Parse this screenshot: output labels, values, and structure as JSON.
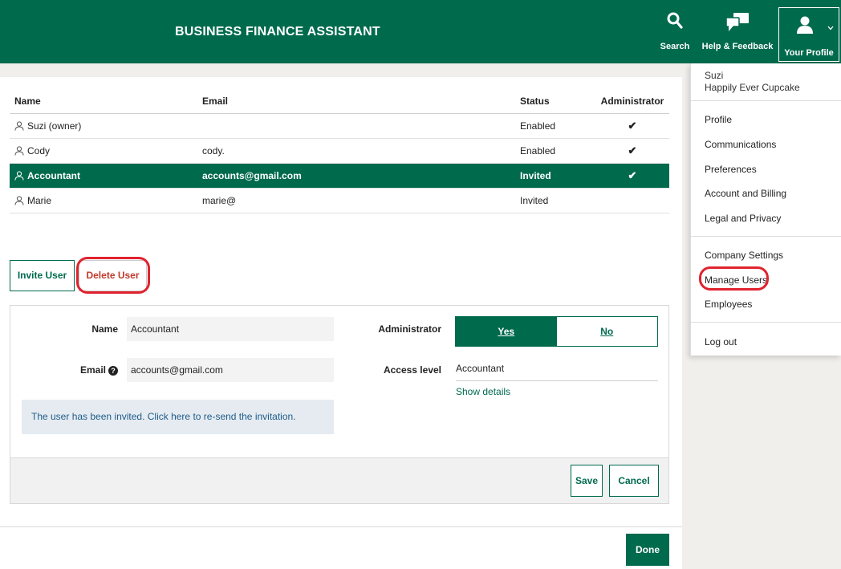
{
  "header": {
    "title": "BUSINESS FINANCE ASSISTANT",
    "search_label": "Search",
    "help_label": "Help & Feedback",
    "profile_label": "Your Profile"
  },
  "table": {
    "headers": {
      "name": "Name",
      "email": "Email",
      "status": "Status",
      "admin": "Administrator"
    },
    "rows": [
      {
        "name": "Suzi (owner)",
        "email": "",
        "status": "Enabled",
        "admin": "✔"
      },
      {
        "name": "Cody",
        "email": "cody.",
        "status": "Enabled",
        "admin": "✔"
      },
      {
        "name": "Accountant",
        "email": "accounts@gmail.com",
        "status": "Invited",
        "admin": "✔"
      },
      {
        "name": "Marie",
        "email": "marie@",
        "status": "Invited",
        "admin": ""
      }
    ]
  },
  "actions": {
    "invite": "Invite User",
    "delete": "Delete User"
  },
  "form": {
    "name_label": "Name",
    "name_value": "Accountant",
    "email_label": "Email",
    "email_help": "?",
    "email_value": "accounts@gmail.com",
    "notice": "The user has been invited. Click here to re-send the invitation.",
    "admin_label": "Administrator",
    "admin_yes": "Yes",
    "admin_no": "No",
    "access_label": "Access level",
    "access_value": "Accountant",
    "show_details": "Show details",
    "save": "Save",
    "cancel": "Cancel"
  },
  "done": "Done",
  "profile_menu": {
    "user_name": "Suzi",
    "company": "Happily Ever Cupcake",
    "items1": [
      "Profile",
      "Communications",
      "Preferences",
      "Account and Billing",
      "Legal and Privacy"
    ],
    "items2": [
      "Company Settings",
      "Manage Users",
      "Employees"
    ],
    "logout": "Log out"
  },
  "colors": {
    "brand": "#006a4d",
    "highlight": "#e0232e",
    "notice_bg": "#e5ebf0"
  },
  "icons": [
    "search-icon",
    "chat-bubble-icon",
    "user-icon",
    "chevron-down-icon",
    "person-outline-icon",
    "checkmark-icon",
    "question-circle-icon"
  ]
}
